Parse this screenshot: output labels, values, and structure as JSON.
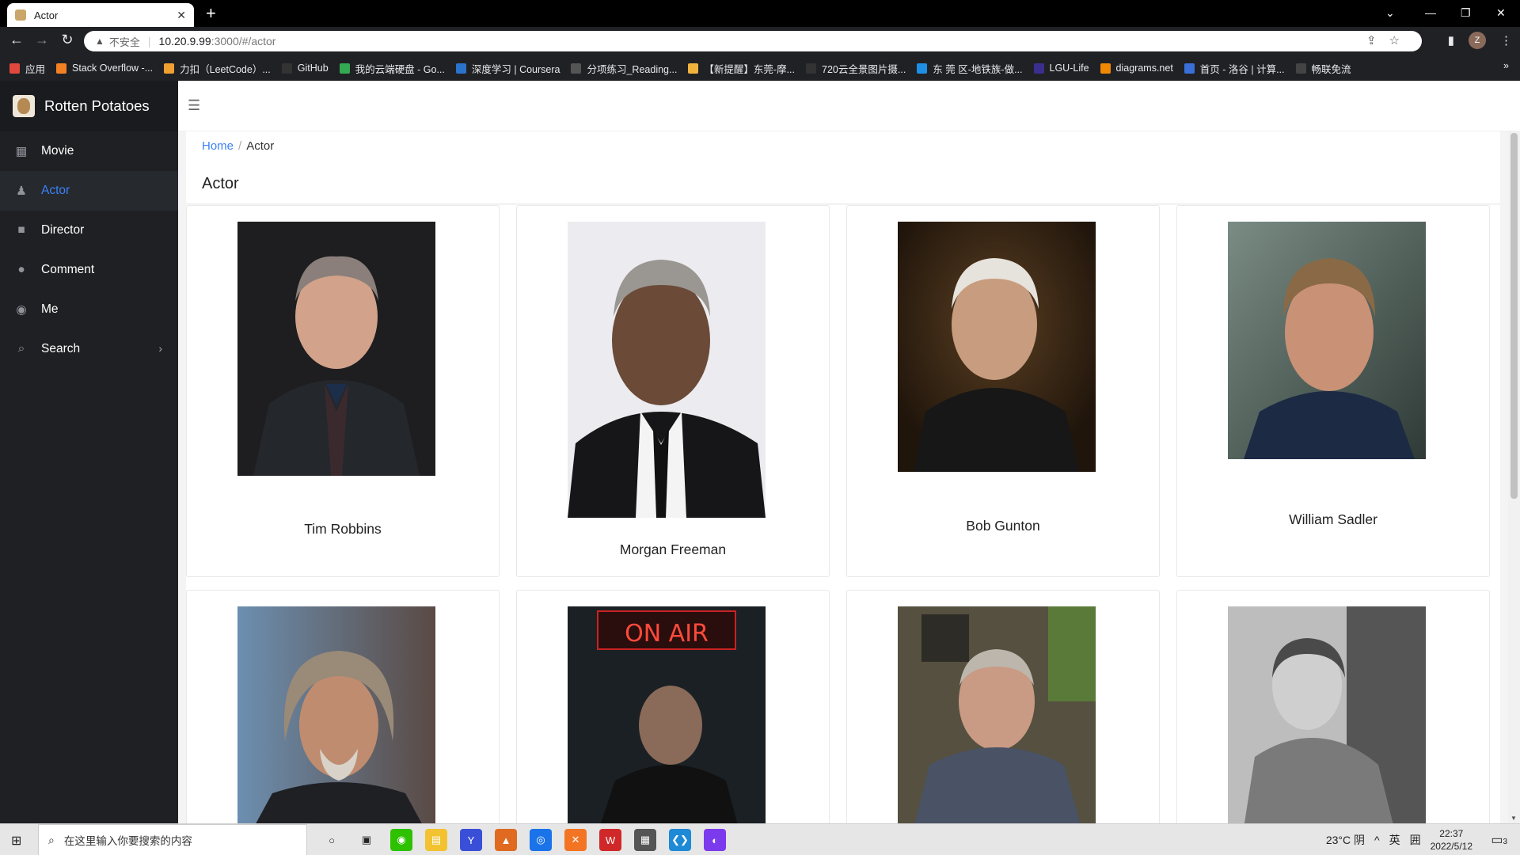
{
  "browser": {
    "tab_title": "Actor",
    "omnibox_security": "不安全",
    "url_host": "10.20.9.99",
    "url_rest": ":3000/#/actor",
    "avatar_letter": "Z",
    "bookmarks": [
      {
        "label": "应用",
        "color": "#e0483e"
      },
      {
        "label": "Stack Overflow -...",
        "color": "#f48024"
      },
      {
        "label": "力扣（LeetCode）...",
        "color": "#f0a030"
      },
      {
        "label": "GitHub",
        "color": "#333333"
      },
      {
        "label": "我的云端硬盘 - Go...",
        "color": "#34a853"
      },
      {
        "label": "深度学习 | Coursera",
        "color": "#2a73cc"
      },
      {
        "label": "分项练习_Reading...",
        "color": "#555555"
      },
      {
        "label": "【新提醒】东莞-摩...",
        "color": "#f2b33d"
      },
      {
        "label": "720云全景图片摄...",
        "color": "#333333"
      },
      {
        "label": "东 莞 区-地铁族-做...",
        "color": "#1f8fe5"
      },
      {
        "label": "LGU-Life",
        "color": "#3a2f8f"
      },
      {
        "label": "diagrams.net",
        "color": "#f08705"
      },
      {
        "label": "首页 - 洛谷 | 计算...",
        "color": "#3a6fd8"
      },
      {
        "label": "畅联免流",
        "color": "#444444"
      }
    ]
  },
  "sidebar": {
    "app_name": "Rotten Potatoes",
    "items": [
      {
        "label": "Movie",
        "icon": "film-icon"
      },
      {
        "label": "Actor",
        "icon": "person-icon"
      },
      {
        "label": "Director",
        "icon": "video-camera-icon"
      },
      {
        "label": "Comment",
        "icon": "comment-icon"
      },
      {
        "label": "Me",
        "icon": "user-circle-icon"
      },
      {
        "label": "Search",
        "icon": "search-icon"
      }
    ],
    "active_item": "Actor",
    "accent": "#3b82f6"
  },
  "breadcrumb": {
    "home": "Home",
    "current": "Actor"
  },
  "page_title": "Actor",
  "actors": [
    {
      "name": "Tim Robbins"
    },
    {
      "name": "Morgan Freeman"
    },
    {
      "name": "Bob Gunton"
    },
    {
      "name": "William Sadler"
    },
    {
      "name": ""
    },
    {
      "name": ""
    },
    {
      "name": ""
    },
    {
      "name": ""
    }
  ],
  "photo_labels": {
    "on_air": "ON AIR"
  },
  "taskbar": {
    "search_placeholder": "在这里输入你要搜索的内容",
    "weather": "23°C 阴",
    "ime": "英",
    "time": "22:37",
    "date": "2022/5/12",
    "notifications": "3"
  }
}
